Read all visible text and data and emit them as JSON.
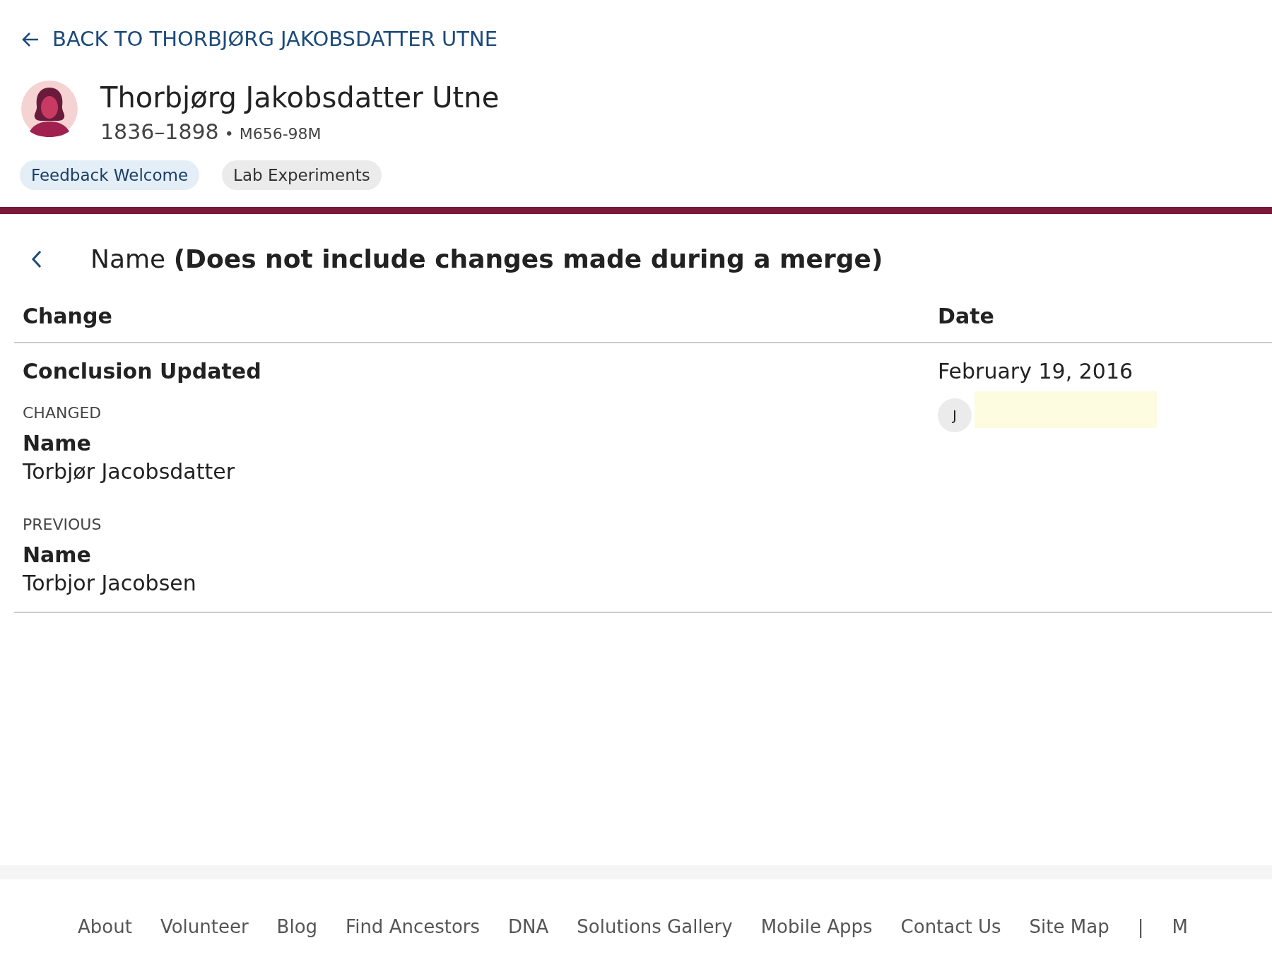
{
  "back_link": "BACK TO THORBJØRG JAKOBSDATTER UTNE",
  "person": {
    "name": "Thorbjørg Jakobsdatter Utne",
    "lifespan": "1836–1898",
    "separator": "•",
    "id": "M656-98M"
  },
  "tags": [
    {
      "label": "Feedback Welcome",
      "kind": "info"
    },
    {
      "label": "Lab Experiments",
      "kind": "neutral"
    }
  ],
  "section_title": "Name **(Does not include changes made during a merge)**",
  "table": {
    "columns": [
      "Change",
      "Date"
    ],
    "rows": [
      {
        "change_type": "Conclusion Updated",
        "date": "February 19, 2016",
        "contributor_initial": "J",
        "blocks": [
          {
            "kind": "CHANGED",
            "field": "Name",
            "value": "Torbjør Jacobsdatter"
          },
          {
            "kind": "PREVIOUS",
            "field": "Name",
            "value": "Torbjor Jacobsen"
          }
        ]
      }
    ]
  },
  "footer_links": [
    "About",
    "Volunteer",
    "Blog",
    "Find Ancestors",
    "DNA",
    "Solutions Gallery",
    "Mobile Apps",
    "Contact Us",
    "Site Map",
    "|",
    "M"
  ]
}
